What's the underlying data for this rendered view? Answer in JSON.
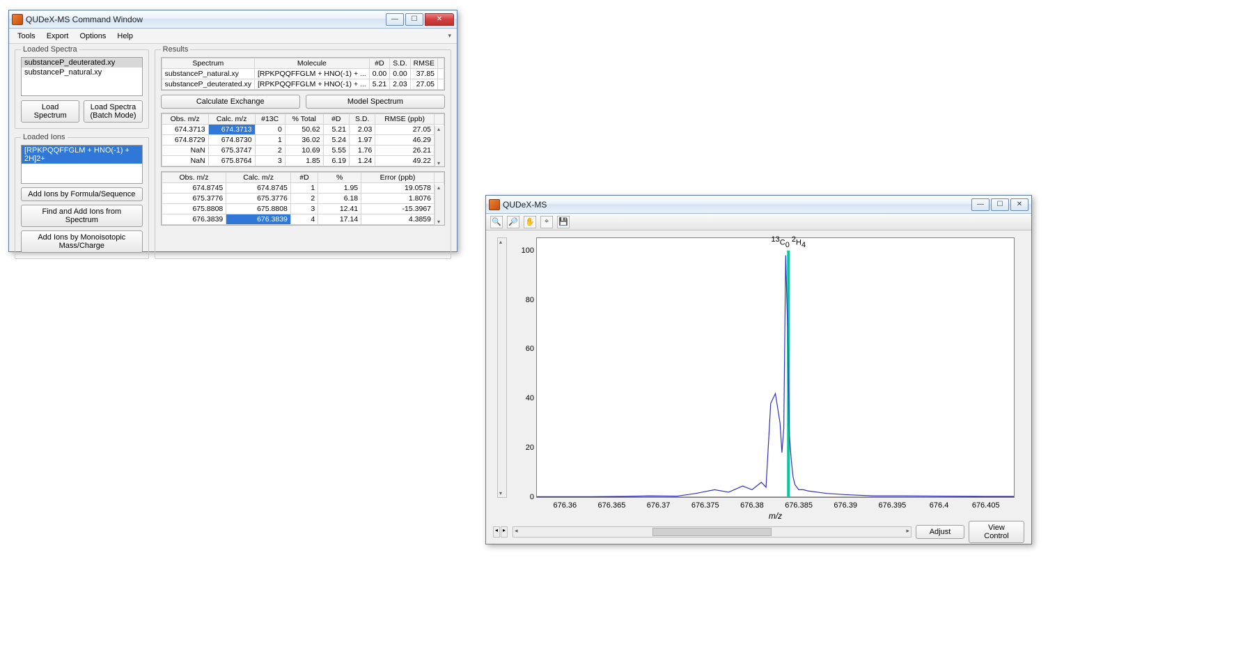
{
  "command_window": {
    "title": "QUDeX-MS Command Window",
    "menu": {
      "tools": "Tools",
      "export": "Export",
      "options": "Options",
      "help": "Help"
    },
    "loaded_spectra": {
      "legend": "Loaded Spectra",
      "items": [
        "substanceP_deuterated.xy",
        "substanceP_natural.xy"
      ],
      "load_btn": "Load Spectrum",
      "batch_btn": "Load Spectra (Batch Mode)"
    },
    "loaded_ions": {
      "legend": "Loaded Ions",
      "items": [
        "[RPKPQQFFGLM + HNO(-1) + 2H]2+"
      ],
      "add_formula_btn": "Add Ions by Formula/Sequence",
      "find_btn": "Find and Add Ions from Spectrum",
      "add_mass_btn": "Add Ions by Monoisotopic Mass/Charge"
    },
    "results": {
      "legend": "Results",
      "headers": {
        "spectrum": "Spectrum",
        "molecule": "Molecule",
        "nd": "#D",
        "sd": "S.D.",
        "rmse": "RMSE"
      },
      "rows": [
        {
          "spectrum": "substanceP_natural.xy",
          "molecule": "[RPKPQQFFGLM + HNO(-1) + ...",
          "nd": "0.00",
          "sd": "0.00",
          "rmse": "37.85"
        },
        {
          "spectrum": "substanceP_deuterated.xy",
          "molecule": "[RPKPQQFFGLM + HNO(-1) + ...",
          "nd": "5.21",
          "sd": "2.03",
          "rmse": "27.05"
        }
      ],
      "calc_btn": "Calculate Exchange",
      "model_btn": "Model Spectrum",
      "isotable": {
        "headers": {
          "obs": "Obs. m/z",
          "calc": "Calc. m/z",
          "n13c": "#13C",
          "pct": "% Total",
          "nd": "#D",
          "sd": "S.D.",
          "rmse": "RMSE (ppb)"
        },
        "rows": [
          {
            "obs": "674.3713",
            "calc": "674.3713",
            "n13c": "0",
            "pct": "50.62",
            "nd": "5.21",
            "sd": "2.03",
            "rmse": "27.05",
            "sel": true
          },
          {
            "obs": "674.8729",
            "calc": "674.8730",
            "n13c": "1",
            "pct": "36.02",
            "nd": "5.24",
            "sd": "1.97",
            "rmse": "46.29"
          },
          {
            "obs": "NaN",
            "calc": "675.3747",
            "n13c": "2",
            "pct": "10.69",
            "nd": "5.55",
            "sd": "1.76",
            "rmse": "26.21"
          },
          {
            "obs": "NaN",
            "calc": "675.8764",
            "n13c": "3",
            "pct": "1.85",
            "nd": "6.19",
            "sd": "1.24",
            "rmse": "49.22"
          }
        ]
      },
      "peaktable": {
        "headers": {
          "obs": "Obs. m/z",
          "calc": "Calc. m/z",
          "nd": "#D",
          "pct": "%",
          "err": "Error (ppb)"
        },
        "rows": [
          {
            "obs": "674.8745",
            "calc": "674.8745",
            "nd": "1",
            "pct": "1.95",
            "err": "19.0578"
          },
          {
            "obs": "675.3776",
            "calc": "675.3776",
            "nd": "2",
            "pct": "6.18",
            "err": "1.8076"
          },
          {
            "obs": "675.8808",
            "calc": "675.8808",
            "nd": "3",
            "pct": "12.41",
            "err": "-15.3967"
          },
          {
            "obs": "676.3839",
            "calc": "676.3839",
            "nd": "4",
            "pct": "17.14",
            "err": "4.3859",
            "sel": true
          }
        ]
      }
    }
  },
  "spectrum_window": {
    "title": "QUDeX-MS",
    "adjust_btn": "Adjust",
    "view_btn": "View Control",
    "xlabel": "m/z",
    "annotation": "13C0 2H4"
  },
  "chart_data": {
    "type": "line",
    "xlabel": "m/z",
    "ylabel": "",
    "ylim": [
      0,
      105
    ],
    "xlim": [
      676.357,
      676.408
    ],
    "yticks": [
      0,
      20,
      40,
      60,
      80,
      100
    ],
    "xticks": [
      676.36,
      676.365,
      676.37,
      676.375,
      676.38,
      676.385,
      676.39,
      676.395,
      676.4,
      676.405
    ],
    "series": [
      {
        "name": "spectrum",
        "color": "#3030c0",
        "x": [
          676.357,
          676.36,
          676.363,
          676.366,
          676.369,
          676.372,
          676.374,
          676.376,
          676.3775,
          676.379,
          676.38,
          676.381,
          676.3815,
          676.382,
          676.3825,
          676.383,
          676.3832,
          676.3834,
          676.3836,
          676.3838,
          676.384,
          676.3842,
          676.3844,
          676.3846,
          676.3848,
          676.385,
          676.3855,
          676.386,
          676.387,
          676.388,
          676.39,
          676.393,
          676.396,
          676.4,
          676.405,
          676.408
        ],
        "y": [
          0.2,
          0.2,
          0.2,
          0.3,
          0.5,
          0.4,
          1.5,
          3.0,
          2.0,
          4.5,
          3.0,
          6.0,
          4.0,
          38,
          42,
          30,
          18,
          28,
          98,
          70,
          25,
          15,
          8,
          5,
          4,
          3,
          3,
          2.5,
          2,
          1.5,
          1,
          0.5,
          0.5,
          0.4,
          0.3,
          0.3
        ]
      }
    ],
    "marker": {
      "x": 676.3839,
      "color": "#00c8a0",
      "label": "13C0 2H4"
    }
  }
}
